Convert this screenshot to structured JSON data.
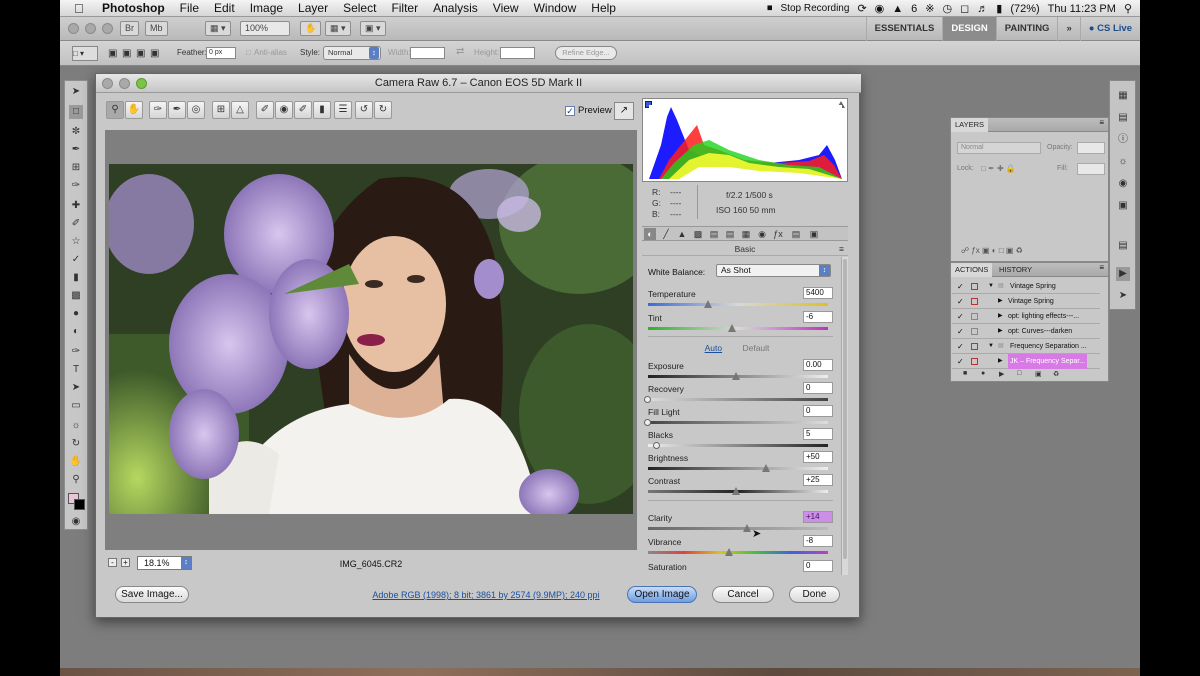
{
  "menubar": {
    "app_name": "Photoshop",
    "items": [
      "File",
      "Edit",
      "Image",
      "Layer",
      "Select",
      "Filter",
      "Analysis",
      "View",
      "Window",
      "Help"
    ],
    "stop_recording": "Stop Recording",
    "battery": "(72%)",
    "clock": "Thu 11:23 PM",
    "adobe_badge": "6"
  },
  "appbar": {
    "zoom_field": "100%",
    "workspaces": [
      "ESSENTIALS",
      "DESIGN",
      "PAINTING"
    ],
    "active_workspace": "DESIGN",
    "more": "»",
    "cs_live": "CS Live"
  },
  "options": {
    "feather_label": "Feather:",
    "feather_value": "0 px",
    "antialias_label": "Anti-alias",
    "style_label": "Style:",
    "style_value": "Normal",
    "width_label": "Width:",
    "height_label": "Height:",
    "refine_edge": "Refine Edge..."
  },
  "camera_raw": {
    "title": "Camera Raw 6.7  –  Canon EOS 5D Mark II",
    "preview_label": "Preview",
    "zoom": "18.1%",
    "filename": "IMG_6045.CR2",
    "info": {
      "r": "R:",
      "g": "G:",
      "b": "B:",
      "dashes": "----",
      "aperture_shutter": "f/2.2   1/500 s",
      "iso_lens": "ISO 160   50 mm"
    },
    "panel_title": "Basic",
    "white_balance_label": "White Balance:",
    "white_balance_value": "As Shot",
    "auto_label": "Auto",
    "default_label": "Default",
    "sliders": [
      {
        "label": "Temperature",
        "value": "5400",
        "pos": 0.34
      },
      {
        "label": "Tint",
        "value": "-6",
        "pos": 0.48
      },
      {
        "label": "Exposure",
        "value": "0.00",
        "pos": 0.5
      },
      {
        "label": "Recovery",
        "value": "0",
        "pos": 0.0
      },
      {
        "label": "Fill Light",
        "value": "0",
        "pos": 0.0
      },
      {
        "label": "Blacks",
        "value": "5",
        "pos": 0.05
      },
      {
        "label": "Brightness",
        "value": "+50",
        "pos": 0.67
      },
      {
        "label": "Contrast",
        "value": "+25",
        "pos": 0.5
      },
      {
        "label": "Clarity",
        "value": "+14",
        "pos": 0.56
      },
      {
        "label": "Vibrance",
        "value": "-8",
        "pos": 0.46
      },
      {
        "label": "Saturation",
        "value": "0",
        "pos": 0.5
      }
    ],
    "save_image": "Save Image...",
    "workflow_link": "Adobe RGB (1998); 8 bit; 3861 by 2574 (9.9MP); 240 ppi",
    "open_image": "Open Image",
    "cancel": "Cancel",
    "done": "Done"
  },
  "layers_panel": {
    "tab": "LAYERS",
    "blend": "Normal",
    "opacity_label": "Opacity:",
    "lock_label": "Lock:",
    "fill_label": "Fill:"
  },
  "actions_panel": {
    "tabs": [
      "ACTIONS",
      "HISTORY"
    ],
    "rows": [
      {
        "text": "Vintage Spring",
        "folder": true,
        "highlight": false
      },
      {
        "text": "Vintage Spring",
        "folder": false,
        "highlight": false
      },
      {
        "text": "opt: lighting effects---...",
        "folder": false,
        "highlight": false
      },
      {
        "text": "opt: Curves---darken",
        "folder": false,
        "highlight": false
      },
      {
        "text": "Frequency Separation ...",
        "folder": true,
        "highlight": false
      },
      {
        "text": "JK – Frequency Separ...",
        "folder": false,
        "highlight": true
      }
    ]
  },
  "colors": {
    "accent": "#5a7fc4",
    "highlight": "#d77ae6",
    "link": "#1a4f9c"
  }
}
